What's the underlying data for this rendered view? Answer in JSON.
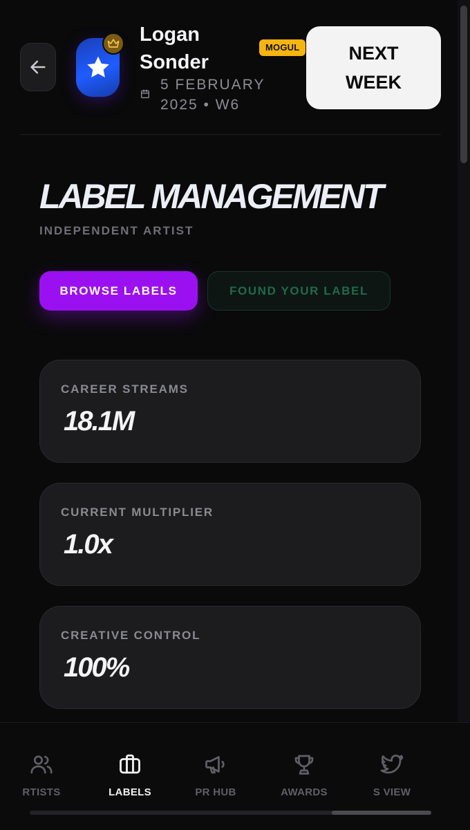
{
  "header": {
    "artist_name": "Logan Sonder",
    "tier_badge": "MOGUL",
    "date": "5 FEBRUARY 2025 • W6",
    "next_week_label": "NEXT WEEK"
  },
  "page": {
    "title": "LABEL MANAGEMENT",
    "subtitle": "INDEPENDENT ARTIST"
  },
  "tabs": [
    {
      "label": "BROWSE LABELS",
      "active": true
    },
    {
      "label": "FOUND YOUR LABEL",
      "active": false
    }
  ],
  "stats": [
    {
      "label": "CAREER STREAMS",
      "value": "18.1M"
    },
    {
      "label": "CURRENT MULTIPLIER",
      "value": "1.0x"
    },
    {
      "label": "CREATIVE CONTROL",
      "value": "100%"
    }
  ],
  "bottom_nav": [
    {
      "label": "RTISTS",
      "icon": "users-icon",
      "active": false
    },
    {
      "label": "LABELS",
      "icon": "briefcase-icon",
      "active": true
    },
    {
      "label": "PR HUB",
      "icon": "megaphone-icon",
      "active": false
    },
    {
      "label": "AWARDS",
      "icon": "trophy-icon",
      "active": false
    },
    {
      "label": "S VIEW",
      "icon": "bird-icon",
      "active": false
    }
  ],
  "colors": {
    "background": "#0a0a0b",
    "accent_purple": "#9b10f0",
    "badge_gold": "#f6b40e",
    "avatar_blue": "#1f5cff",
    "found_label_green": "#1f6a4a"
  }
}
